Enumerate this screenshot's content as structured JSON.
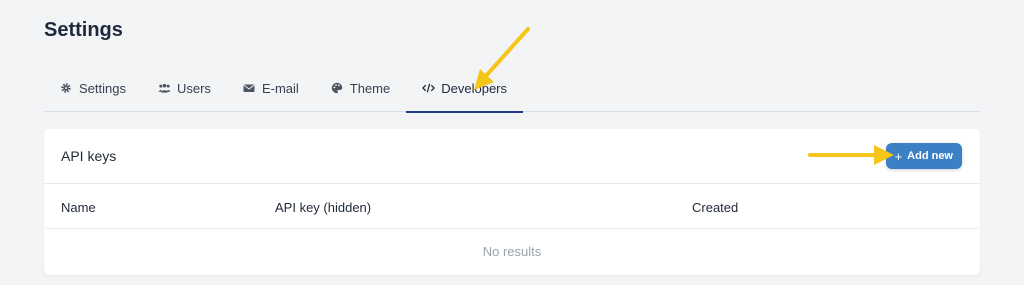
{
  "page": {
    "title": "Settings"
  },
  "tabs": [
    {
      "label": "Settings",
      "icon": "gear-icon"
    },
    {
      "label": "Users",
      "icon": "users-icon"
    },
    {
      "label": "E-mail",
      "icon": "envelope-icon"
    },
    {
      "label": "Theme",
      "icon": "palette-icon"
    },
    {
      "label": "Developers",
      "icon": "code-icon",
      "active": true
    }
  ],
  "api_keys": {
    "title": "API keys",
    "add_button": {
      "label": "Add new",
      "icon": "plus-icon"
    },
    "columns": [
      "Name",
      "API key (hidden)",
      "Created"
    ],
    "rows": [],
    "empty_text": "No results"
  },
  "colors": {
    "accent": "#3b7fc4",
    "active_tab_underline": "#1e3a8a",
    "annotation_arrow": "#f5c518",
    "background": "#f3f4f6"
  }
}
